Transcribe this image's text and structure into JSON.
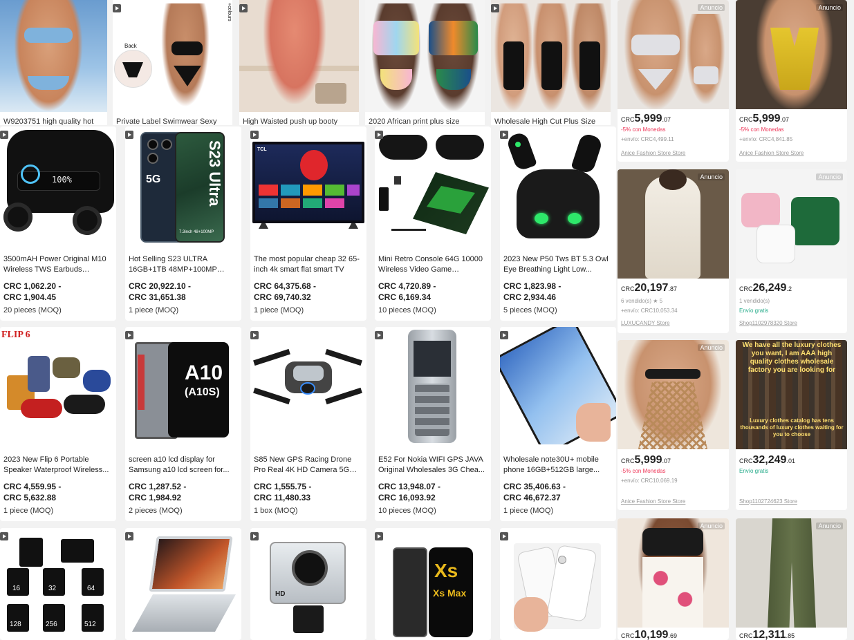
{
  "top_strip": [
    {
      "title": "W9203751 high quality hot"
    },
    {
      "title": "Private Label Swimwear Sexy"
    },
    {
      "title": "High Waisted push up booty"
    },
    {
      "title": "2020 African print plus size"
    },
    {
      "title": "Wholesale High Cut Plus Size"
    }
  ],
  "top_strip_labels": {
    "back": "Back",
    "colours": "+colours"
  },
  "products": [
    {
      "title": "3500mAH Power Original M10 Wireless TWS Earbuds Gamin...",
      "price_min": "CRC 1,062.20 -",
      "price_max": "CRC 1,904.45",
      "moq": "20 pieces (MOQ)"
    },
    {
      "title": "Hot Selling S23 ULTRA 16GB+1TB 48MP+100MP 7.3...",
      "price_min": "CRC 20,922.10 -",
      "price_max": "CRC 31,651.38",
      "moq": "1 piece (MOQ)"
    },
    {
      "title": "The most popular cheap 32 65-inch 4k smart flat smart TV",
      "price_min": "CRC 64,375.68 -",
      "price_max": "CRC 69,740.32",
      "moq": "1 piece (MOQ)"
    },
    {
      "title": "Mini Retro Console 64G 10000 Wireless Video Game Console...",
      "price_min": "CRC 4,720.89 -",
      "price_max": "CRC 6,169.34",
      "moq": "10 pieces (MOQ)"
    },
    {
      "title": "2023 New P50 Tws BT 5.3 Owl Eye Breathing Light Low...",
      "price_min": "CRC 1,823.98 -",
      "price_max": "CRC 2,934.46",
      "moq": "5 pieces (MOQ)"
    },
    {
      "title": "2023 New Flip 6 Portable Speaker Waterproof Wireless...",
      "price_min": "CRC 4,559.95 -",
      "price_max": "CRC 5,632.88",
      "moq": "1 piece (MOQ)"
    },
    {
      "title": "screen a10 lcd display for Samsung a10 lcd screen for...",
      "price_min": "CRC 1,287.52 -",
      "price_max": "CRC 1,984.92",
      "moq": "2 pieces (MOQ)"
    },
    {
      "title": "S85 New GPS Racing Drone Pro Real 4K HD Camera 5G Long...",
      "price_min": "CRC 1,555.75 -",
      "price_max": "CRC 11,480.33",
      "moq": "1 box (MOQ)"
    },
    {
      "title": "E52 For Nokia WIFI GPS JAVA Original Wholesales 3G Chea...",
      "price_min": "CRC 13,948.07 -",
      "price_max": "CRC 16,093.92",
      "moq": "10 pieces (MOQ)"
    },
    {
      "title": "Wholesale note30U+ mobile phone 16GB+512GB large...",
      "price_min": "CRC 35,406.63 -",
      "price_max": "CRC 46,672.37",
      "moq": "1 piece (MOQ)"
    }
  ],
  "product_image_labels": {
    "earbuds_display": "100%",
    "phone_5g": "5G",
    "phone_s23": "S23 Ultra",
    "phone_specs": "7.3inch 48+100MP",
    "tv_brand": "TCL",
    "flip": "FLIP 6",
    "a10": "A10",
    "a10s": "(A10S)",
    "xs": "Xs",
    "xsmax": "Xs Max",
    "hd": "HD",
    "sd_16": "16",
    "sd_32": "32",
    "sd_64": "64",
    "sd_128": "128",
    "sd_256": "256",
    "sd_512": "512"
  },
  "ads": [
    {
      "badge": "Anuncio",
      "currency": "CRC",
      "price": "5,999",
      "cents": ".07",
      "line1": "-5% con Monedas",
      "line2": "+envío: CRC4,499.11",
      "store": "Anice Fashion Store Store"
    },
    {
      "badge": "Anuncio",
      "currency": "CRC",
      "price": "5,999",
      "cents": ".07",
      "line1": "-5% con Monedas",
      "line2": "+envío: CRC4,841.85",
      "store": "Anice Fashion Store Store"
    },
    {
      "badge": "Anuncio",
      "currency": "CRC",
      "price": "20,197",
      "cents": ".87",
      "line1": "6 vendido(s) ★ 5",
      "line2": "+envío: CRC10,053.34",
      "store": "LUXUCANDY Store"
    },
    {
      "badge": "Anuncio",
      "currency": "CRC",
      "price": "26,249",
      "cents": ".2",
      "line1": "1 vendido(s)",
      "line2": "Envío gratis",
      "store": "Shop1102978320 Store"
    },
    {
      "badge": "Anuncio",
      "currency": "CRC",
      "price": "5,999",
      "cents": ".07",
      "line1": "-5% con Monedas",
      "line2": "+envío: CRC10,069.19",
      "store": "Anice Fashion Store Store"
    },
    {
      "badge": "",
      "currency": "CRC",
      "price": "32,249",
      "cents": ".01",
      "line1": "Envío gratis",
      "line2": "",
      "store": "Shop1102724623 Store"
    },
    {
      "badge": "Anuncio",
      "currency": "CRC",
      "price": "10,199",
      "cents": ".69",
      "line1": "",
      "line2": "",
      "store": ""
    },
    {
      "badge": "Anuncio",
      "currency": "CRC",
      "price": "12,311",
      "cents": ".85",
      "line1": "",
      "line2": "",
      "store": ""
    }
  ],
  "ad_banner_text": "We have all the luxury clothes you want, I am AAA high quality clothes wholesale factory you are looking for",
  "ad_banner_text2": "Luxury clothes catalog has tens thousands of luxury clothes waiting for you to choose",
  "colors": {
    "price": "#222222",
    "discount": "#ee3355",
    "free_shipping": "#22aa88",
    "card_bg": "#ffffff",
    "page_bg": "#f2f2f2"
  }
}
